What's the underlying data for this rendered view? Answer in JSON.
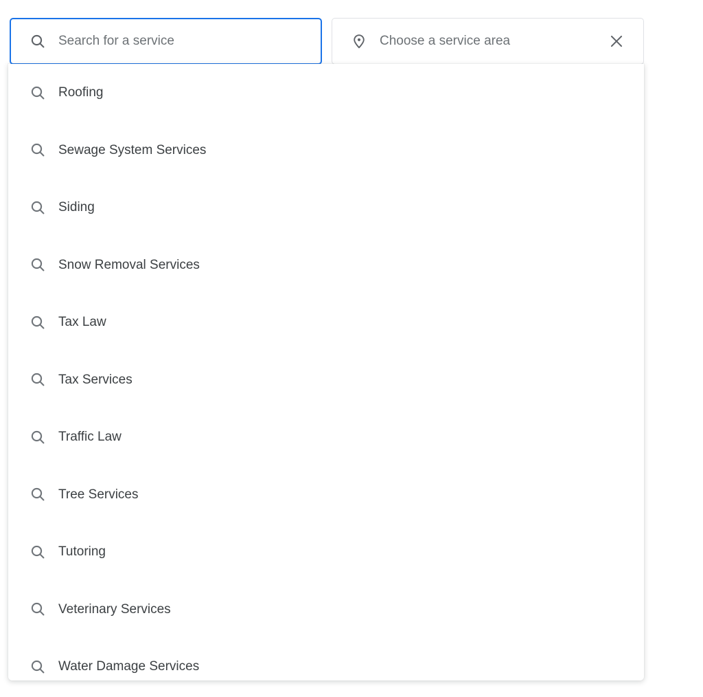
{
  "search": {
    "service_field": {
      "icon": "search-icon",
      "placeholder": "Search for a service",
      "value": "",
      "focused": true,
      "border_color": "#1a73e8"
    },
    "area_field": {
      "icon": "location-pin-icon",
      "placeholder": "Choose a service area",
      "value": "",
      "clear_icon": "close-icon",
      "border_color": "#dfe1e5"
    }
  },
  "dropdown": {
    "visible": true,
    "item_icon": "search-icon",
    "items": [
      {
        "label": "Roofing"
      },
      {
        "label": "Sewage System Services"
      },
      {
        "label": "Siding"
      },
      {
        "label": "Snow Removal Services"
      },
      {
        "label": "Tax Law"
      },
      {
        "label": "Tax Services"
      },
      {
        "label": "Traffic Law"
      },
      {
        "label": "Tree Services"
      },
      {
        "label": "Tutoring"
      },
      {
        "label": "Veterinary Services"
      },
      {
        "label": "Water Damage Services"
      }
    ]
  },
  "colors": {
    "text_primary": "#3c4043",
    "text_placeholder": "#6d7276",
    "icon": "#70757a",
    "accent_blue": "#1a73e8",
    "border_gray": "#dfe1e5",
    "background": "#ffffff"
  }
}
